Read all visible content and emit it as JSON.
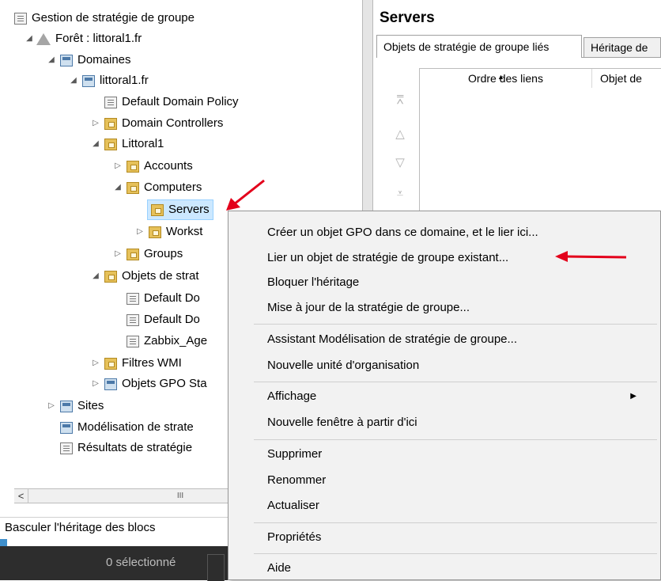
{
  "tree": {
    "items": [
      {
        "label": "Gestion de stratégie de groupe",
        "icon": "gpmc-icon",
        "toggle": ""
      },
      {
        "label": "Forêt : littoral1.fr",
        "icon": "forest-icon",
        "toggle": "◢"
      },
      {
        "label": "Domaines",
        "icon": "domains-icon",
        "toggle": "◢"
      },
      {
        "label": "littoral1.fr",
        "icon": "domain-icon",
        "toggle": "◢"
      },
      {
        "label": "Default Domain Policy",
        "icon": "gpo-link-icon",
        "toggle": ""
      },
      {
        "label": "Domain Controllers",
        "icon": "ou-folder-icon",
        "toggle": "▷"
      },
      {
        "label": "Littoral1",
        "icon": "ou-folder-icon",
        "toggle": "◢"
      },
      {
        "label": "Accounts",
        "icon": "ou-folder-icon",
        "toggle": "▷"
      },
      {
        "label": "Computers",
        "icon": "ou-folder-icon",
        "toggle": "◢"
      },
      {
        "label": "Servers",
        "icon": "ou-folder-icon",
        "toggle": ""
      },
      {
        "label": "Workst",
        "icon": "ou-folder-icon",
        "toggle": "▷"
      },
      {
        "label": "Groups",
        "icon": "ou-folder-icon",
        "toggle": "▷"
      },
      {
        "label": "Objets de strat",
        "icon": "gpo-container-icon",
        "toggle": "◢"
      },
      {
        "label": "Default Do",
        "icon": "gpo-icon",
        "toggle": ""
      },
      {
        "label": "Default Do",
        "icon": "gpo-icon",
        "toggle": ""
      },
      {
        "label": "Zabbix_Age",
        "icon": "gpo-icon",
        "toggle": ""
      },
      {
        "label": "Filtres WMI",
        "icon": "wmi-filter-icon",
        "toggle": "▷"
      },
      {
        "label": "Objets GPO Sta",
        "icon": "starter-gpo-icon",
        "toggle": "▷"
      },
      {
        "label": "Sites",
        "icon": "sites-icon",
        "toggle": "▷"
      },
      {
        "label": "Modélisation de strate",
        "icon": "modeling-icon",
        "toggle": ""
      },
      {
        "label": "Résultats de stratégie",
        "icon": "results-icon",
        "toggle": ""
      }
    ],
    "scroll_thumb": "III",
    "scroll_left": "<"
  },
  "status_text": "Basculer l'héritage des blocs",
  "taskbar_text": "0 sélectionné",
  "right": {
    "title": "Servers",
    "tabs": [
      "Objets de stratégie de groupe liés",
      "Héritage de"
    ],
    "columns": [
      "Ordre des liens",
      "Objet de"
    ]
  },
  "menu": {
    "items": [
      "Créer un objet GPO dans ce domaine, et le lier ici...",
      "Lier un objet de stratégie de groupe existant...",
      "Bloquer l'héritage",
      "Mise à jour de la stratégie de groupe...",
      "Assistant Modélisation de stratégie de groupe...",
      "Nouvelle unité d'organisation",
      "Affichage",
      "Nouvelle fenêtre à partir d'ici",
      "Supprimer",
      "Renommer",
      "Actualiser",
      "Propriétés",
      "Aide"
    ]
  },
  "colors": {
    "annotation_arrow": "#e3001b",
    "selection": "#cce8ff",
    "taskbar": "#2d2d2d"
  }
}
